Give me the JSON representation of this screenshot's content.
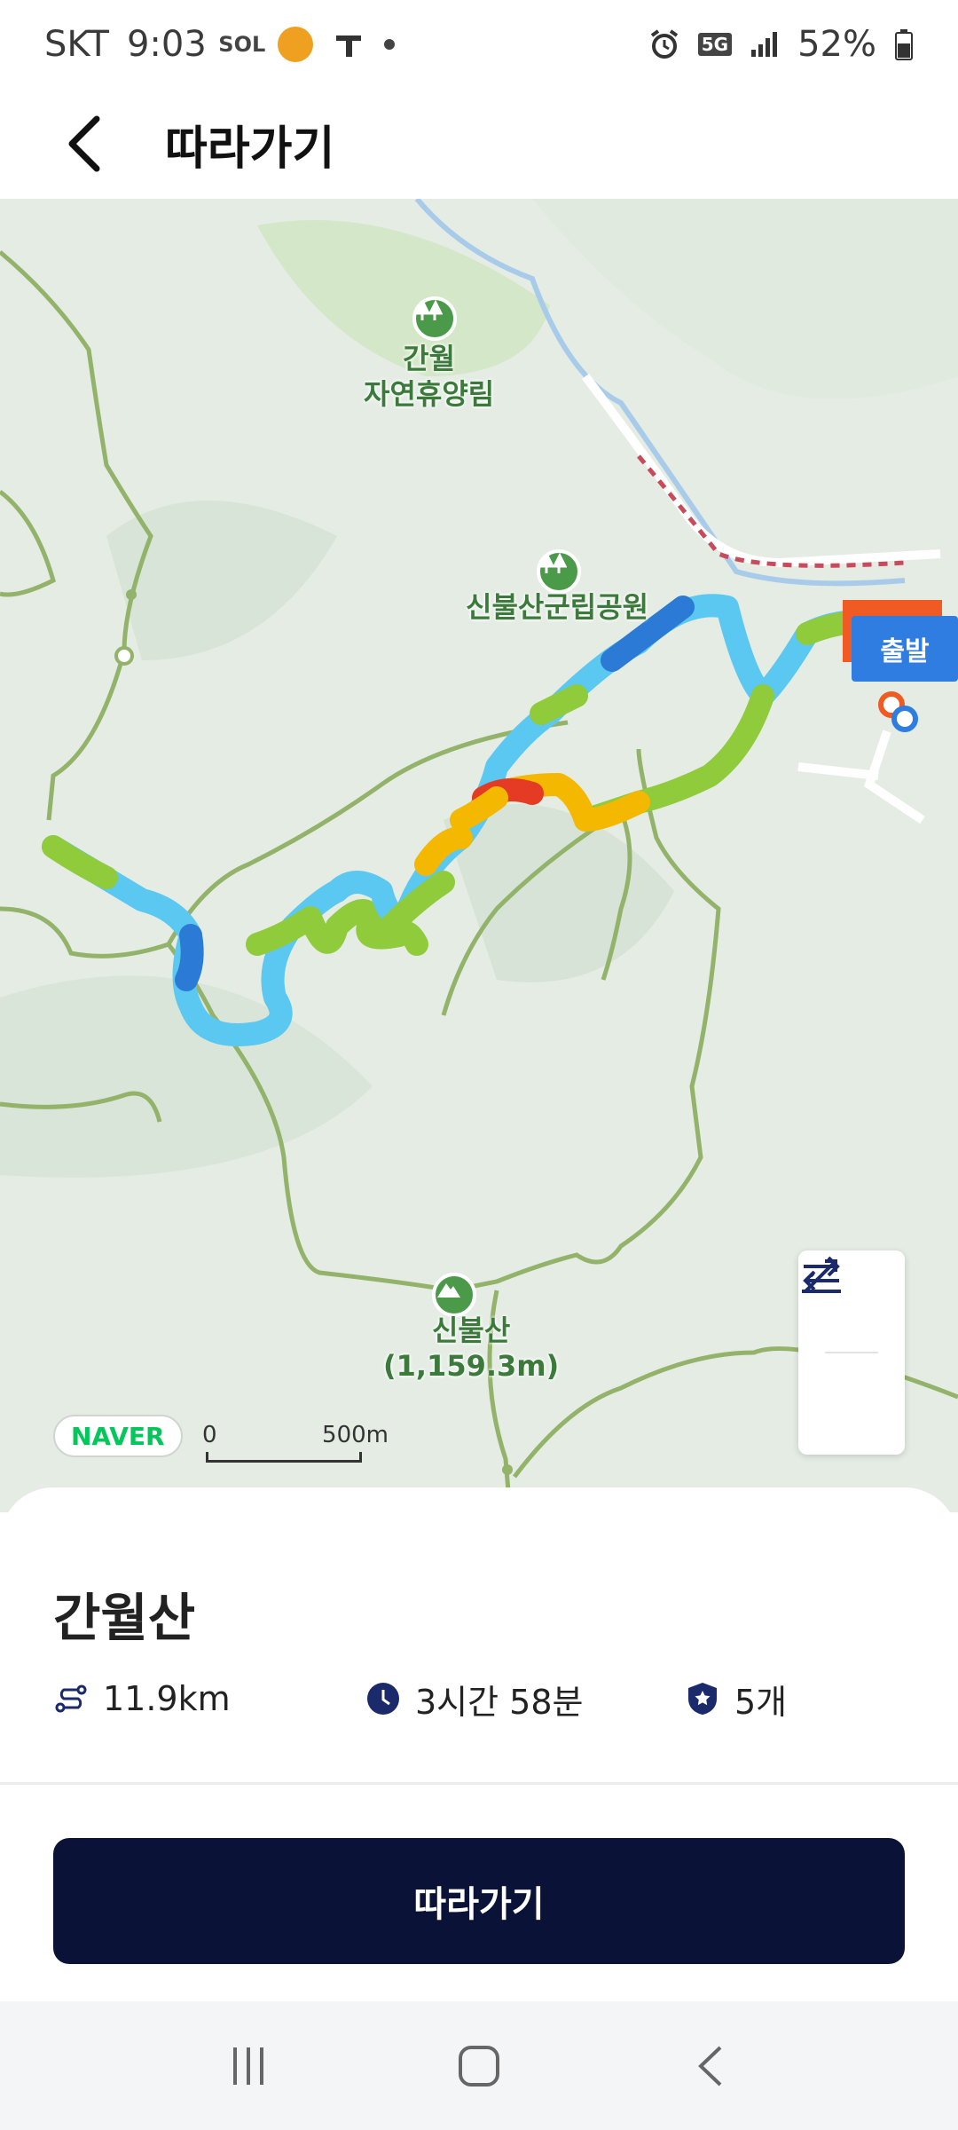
{
  "status_bar": {
    "carrier": "SKT",
    "time": "9:03",
    "network": "5G",
    "battery": "52%"
  },
  "header": {
    "title": "따라가기"
  },
  "map": {
    "labels": {
      "forest": [
        "간월",
        "자연휴양림"
      ],
      "park": "신불산군립공원",
      "peak_name": "신불산",
      "peak_height": "(1,159.3m)"
    },
    "start_badge": "출발",
    "provider_logo": "NAVER",
    "scale": {
      "zero": "0",
      "label": "500m"
    },
    "track_colors": [
      "#8fcb3b",
      "#5ac8f0",
      "#f5b800",
      "#2a7ad6",
      "#e53b24"
    ]
  },
  "course": {
    "name": "간월산",
    "distance": "11.9km",
    "duration": "3시간 58분",
    "stamps": "5개"
  },
  "actions": {
    "follow_label": "따라가기"
  },
  "icons": {
    "back": "chevron-left-icon",
    "altitude": "elevation-icon",
    "swap": "swap-arrows-icon",
    "distance": "route-icon",
    "time": "clock-icon",
    "stamps": "badge-star-icon"
  }
}
